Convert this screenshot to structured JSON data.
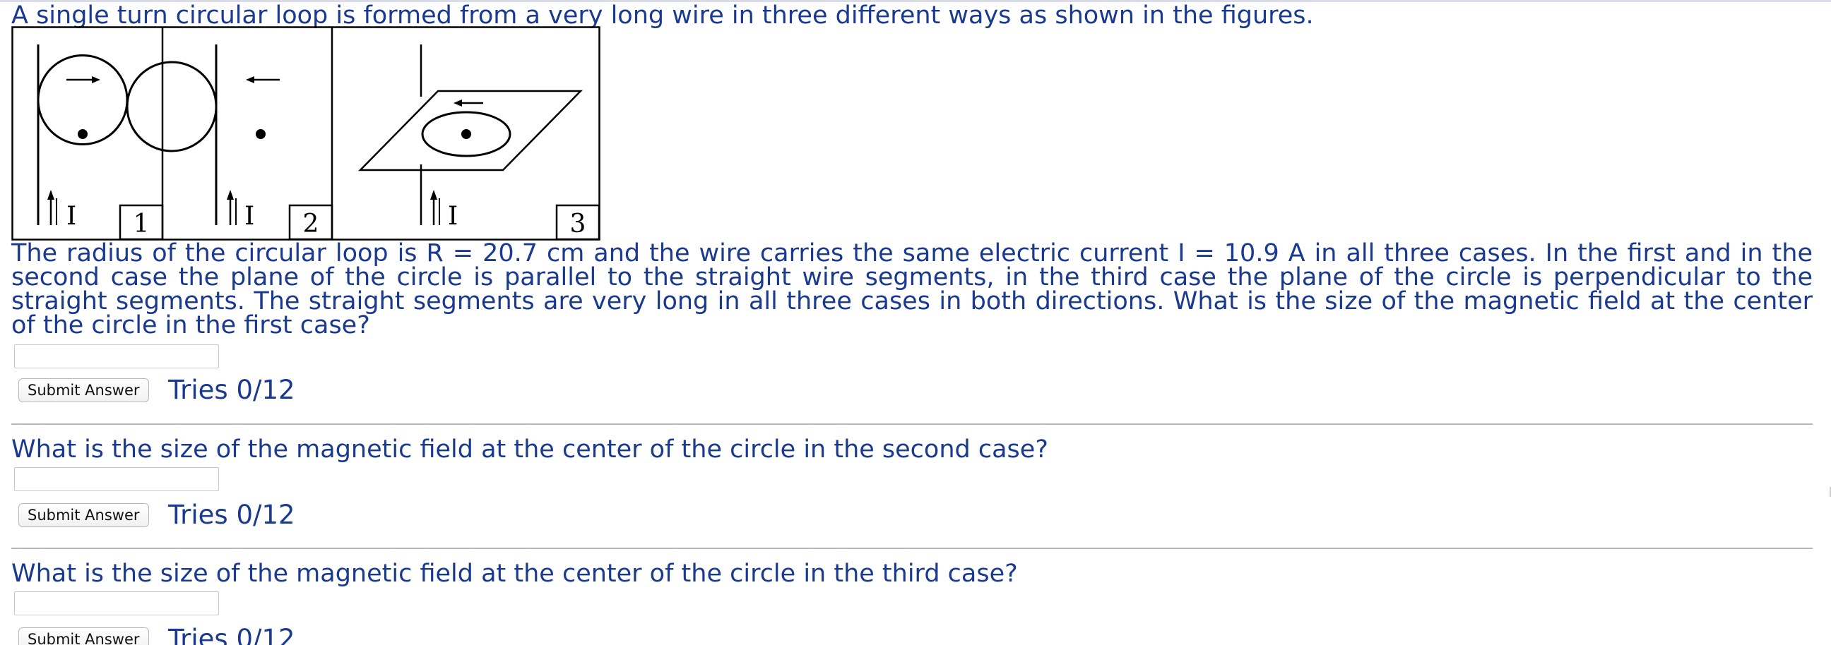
{
  "intro": "A single turn circular loop is formed from a very long wire in three different ways as shown in the figures.",
  "figures": {
    "current_label": "I",
    "panels": [
      {
        "number": "1"
      },
      {
        "number": "2"
      },
      {
        "number": "3"
      }
    ]
  },
  "problem_text": "The radius of the circular loop is R = 20.7 cm and the wire carries the same electric current I = 10.9 A in all three cases. In the first and in the second case the plane of the circle is parallel to the straight wire segments, in the third case the plane of the circle is perpendicular to the straight segments. The straight segments are very long in all three cases in both directions. What is the size of the magnetic field at the center of the circle in the first case?",
  "parts": [
    {
      "question": "",
      "answer_value": "",
      "submit_label": "Submit Answer",
      "tries": "Tries 0/12"
    },
    {
      "question": "What is the size of the magnetic field at the center of the circle in the second case?",
      "answer_value": "",
      "submit_label": "Submit Answer",
      "tries": "Tries 0/12"
    },
    {
      "question": "What is the size of the magnetic field at the center of the circle in the third case?",
      "answer_value": "",
      "submit_label": "Submit Answer",
      "tries": "Tries 0/12"
    }
  ]
}
